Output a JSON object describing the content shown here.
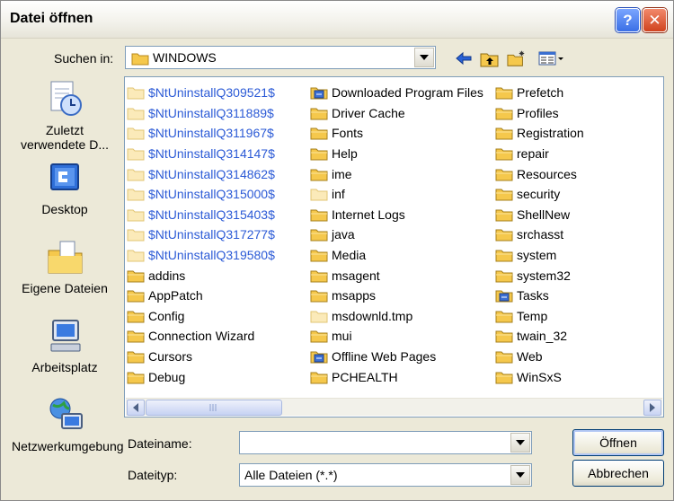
{
  "window": {
    "title": "Datei öffnen",
    "help_glyph": "?",
    "close_glyph": "✕"
  },
  "look_in": {
    "label": "Suchen in:",
    "value": "WINDOWS"
  },
  "places": [
    {
      "label": "Zuletzt verwendete D...",
      "icon": "recent-documents-icon"
    },
    {
      "label": "Desktop",
      "icon": "desktop-icon"
    },
    {
      "label": "Eigene Dateien",
      "icon": "my-documents-icon"
    },
    {
      "label": "Arbeitsplatz",
      "icon": "my-computer-icon"
    },
    {
      "label": "Netzwerkumgebung",
      "icon": "network-places-icon"
    }
  ],
  "files": {
    "col1": [
      {
        "name": "$NtUninstallQ309521$",
        "kind": "hidden"
      },
      {
        "name": "$NtUninstallQ311889$",
        "kind": "hidden"
      },
      {
        "name": "$NtUninstallQ311967$",
        "kind": "hidden"
      },
      {
        "name": "$NtUninstallQ314147$",
        "kind": "hidden"
      },
      {
        "name": "$NtUninstallQ314862$",
        "kind": "hidden"
      },
      {
        "name": "$NtUninstallQ315000$",
        "kind": "hidden"
      },
      {
        "name": "$NtUninstallQ315403$",
        "kind": "hidden"
      },
      {
        "name": "$NtUninstallQ317277$",
        "kind": "hidden"
      },
      {
        "name": "$NtUninstallQ319580$",
        "kind": "hidden"
      },
      {
        "name": "addins",
        "kind": "folder"
      },
      {
        "name": "AppPatch",
        "kind": "folder"
      },
      {
        "name": "Config",
        "kind": "folder"
      },
      {
        "name": "Connection Wizard",
        "kind": "folder"
      },
      {
        "name": "Cursors",
        "kind": "folder"
      },
      {
        "name": "Debug",
        "kind": "folder"
      }
    ],
    "col2": [
      {
        "name": "Downloaded Program Files",
        "kind": "special"
      },
      {
        "name": "Driver Cache",
        "kind": "folder"
      },
      {
        "name": "Fonts",
        "kind": "folder"
      },
      {
        "name": "Help",
        "kind": "folder"
      },
      {
        "name": "ime",
        "kind": "folder"
      },
      {
        "name": "inf",
        "kind": "hiddenplain"
      },
      {
        "name": "Internet Logs",
        "kind": "folder"
      },
      {
        "name": "java",
        "kind": "folder"
      },
      {
        "name": "Media",
        "kind": "folder"
      },
      {
        "name": "msagent",
        "kind": "folder"
      },
      {
        "name": "msapps",
        "kind": "folder"
      },
      {
        "name": "msdownld.tmp",
        "kind": "hiddenplain"
      },
      {
        "name": "mui",
        "kind": "folder"
      },
      {
        "name": "Offline Web Pages",
        "kind": "special"
      },
      {
        "name": "PCHEALTH",
        "kind": "folder"
      }
    ],
    "col3": [
      {
        "name": "Prefetch",
        "kind": "folder"
      },
      {
        "name": "Profiles",
        "kind": "folder"
      },
      {
        "name": "Registration",
        "kind": "folder"
      },
      {
        "name": "repair",
        "kind": "folder"
      },
      {
        "name": "Resources",
        "kind": "folder"
      },
      {
        "name": "security",
        "kind": "folder"
      },
      {
        "name": "ShellNew",
        "kind": "folder"
      },
      {
        "name": "srchasst",
        "kind": "folder"
      },
      {
        "name": "system",
        "kind": "folder"
      },
      {
        "name": "system32",
        "kind": "folder"
      },
      {
        "name": "Tasks",
        "kind": "special"
      },
      {
        "name": "Temp",
        "kind": "folder"
      },
      {
        "name": "twain_32",
        "kind": "folder"
      },
      {
        "name": "Web",
        "kind": "folder"
      },
      {
        "name": "WinSxS",
        "kind": "folder"
      }
    ]
  },
  "filename": {
    "label": "Dateiname:",
    "value": ""
  },
  "filetype": {
    "label": "Dateityp:",
    "value": "Alle Dateien (*.*)"
  },
  "buttons": {
    "open": "Öffnen",
    "cancel": "Abbrechen"
  },
  "colors": {
    "hidden_text": "#2b5ad6",
    "folder": "#f5c84c",
    "window_bg": "#ece9d8",
    "field_border": "#7f9db9"
  }
}
